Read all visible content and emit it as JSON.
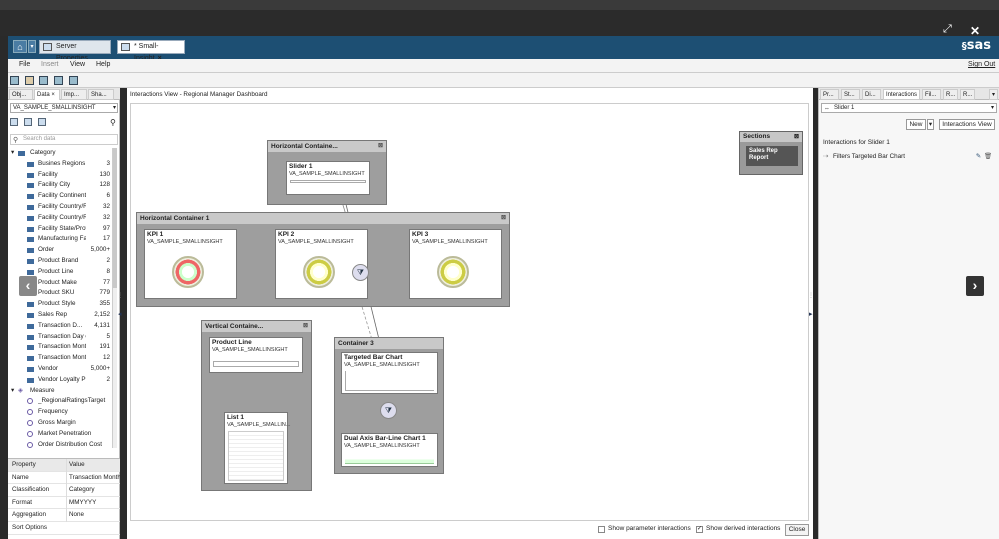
{
  "window": {
    "maximize_icon": "expand-icon",
    "close_icon": "close-icon"
  },
  "tabs": [
    {
      "label": "Server Properties"
    },
    {
      "label": "* Small-Insight",
      "close": "×"
    }
  ],
  "brand": "sas",
  "menu": {
    "file": "File",
    "insert": "Insert",
    "view": "View",
    "help": "Help",
    "sign_out": "Sign Out"
  },
  "left": {
    "tabs": [
      "Obj...",
      "Data",
      "Imp...",
      "Sha..."
    ],
    "data_tab_close": "×",
    "datasource": "VA_SAMPLE_SMALLINSIGHT",
    "search_placeholder": "Search data",
    "category_label": "Category",
    "items": [
      {
        "label": "Busines Regions",
        "count": "3"
      },
      {
        "label": "Facility",
        "count": "130"
      },
      {
        "label": "Facility City",
        "count": "128"
      },
      {
        "label": "Facility Continents",
        "count": "6"
      },
      {
        "label": "Facility Country/R...",
        "count": "32"
      },
      {
        "label": "Facility Country/R...",
        "count": "32"
      },
      {
        "label": "Facility State/Provi...",
        "count": "97"
      },
      {
        "label": "Manufacturing Fac...",
        "count": "17"
      },
      {
        "label": "Order",
        "count": "5,000+"
      },
      {
        "label": "Product Brand",
        "count": "2"
      },
      {
        "label": "Product Line",
        "count": "8"
      },
      {
        "label": "Product Make",
        "count": "77"
      },
      {
        "label": "Product SKU",
        "count": "779"
      },
      {
        "label": "Product Style",
        "count": "355"
      },
      {
        "label": "Sales Rep",
        "count": "2,152"
      },
      {
        "label": "Transaction D...",
        "count": "4,131"
      },
      {
        "label": "Transaction Day of...",
        "count": "5"
      },
      {
        "label": "Transaction Month",
        "count": "191"
      },
      {
        "label": "Transaction Mont...",
        "count": "12"
      },
      {
        "label": "Vendor",
        "count": "5,000+"
      },
      {
        "label": "Vendor Loyalty Pro...",
        "count": "2"
      }
    ],
    "measure_label": "Measure",
    "measures": [
      "_RegionalRatingsTarget",
      "Frequency",
      "Gross Margin",
      "Market Penetration",
      "Order Distribution Cost"
    ],
    "properties": {
      "header_key": "Property",
      "header_value": "Value",
      "rows": [
        {
          "k": "Name",
          "v": "Transaction Month"
        },
        {
          "k": "Classification",
          "v": "Category"
        },
        {
          "k": "Format",
          "v": "MMYYYY"
        },
        {
          "k": "Aggregation",
          "v": "None"
        },
        {
          "k": "Sort Options",
          "v": ""
        }
      ]
    }
  },
  "main": {
    "title": "Interactions View - Regional Manager Dashboard",
    "h_container_top": "Horizontal Containe...",
    "slider_title": "Slider 1",
    "ds": "VA_SAMPLE_SMALLINSIGHT",
    "h_container_1": "Horizontal Container 1",
    "kpi1": "KPI 1",
    "kpi2": "KPI 2",
    "kpi3": "KPI 3",
    "v_container": "Vertical Containe...",
    "product_line": "Product Line",
    "list1": "List 1",
    "list_ds": "VA_SAMPLE_SMALLIN...",
    "container3": "Container 3",
    "targeted_bar": "Targeted Bar Chart",
    "dual_axis": "Dual Axis Bar-Line Chart 1",
    "sections_title": "Sections",
    "sales_rep_report": "Sales Rep Report",
    "show_param": "Show parameter interactions",
    "show_derived": "Show derived interactions",
    "close": "Close",
    "show_param_checked": false,
    "show_derived_checked": true
  },
  "right": {
    "tabs": [
      "Pr...",
      "St...",
      "Di...",
      "Interactions",
      "Fil...",
      "R...",
      "R..."
    ],
    "selected_object": "Slider 1",
    "new_button": "New",
    "interactions_view_button": "Interactions View",
    "heading": "Interactions for Slider 1",
    "interaction": "Filters Targeted Bar Chart"
  },
  "colors": {
    "tabbar": "#1d4f73",
    "topbar": "#2b2b2b",
    "container": "#9e9e9e"
  }
}
